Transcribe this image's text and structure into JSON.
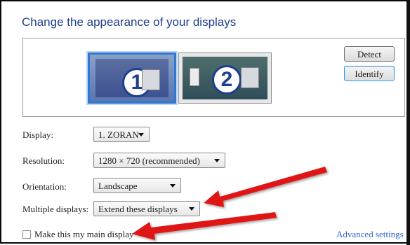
{
  "header": {
    "title": "Change the appearance of your displays"
  },
  "preview": {
    "monitor1_number": "1",
    "monitor2_number": "2",
    "detect_label": "Detect",
    "identify_label": "Identify"
  },
  "settings": {
    "display": {
      "label": "Display:",
      "value": "1. ZORAN"
    },
    "resolution": {
      "label": "Resolution:",
      "value": "1280 × 720 (recommended)"
    },
    "orientation": {
      "label": "Orientation:",
      "value": "Landscape"
    },
    "multiple_displays": {
      "label": "Multiple displays:",
      "value": "Extend these displays"
    }
  },
  "main_display": {
    "label": "Make this my main display",
    "checked": false
  },
  "advanced_link": "Advanced settings",
  "colors": {
    "title": "#1e3e8c",
    "selected_border": "#2f77d1",
    "annotation_arrow": "#e01818",
    "link": "#3366cc"
  }
}
